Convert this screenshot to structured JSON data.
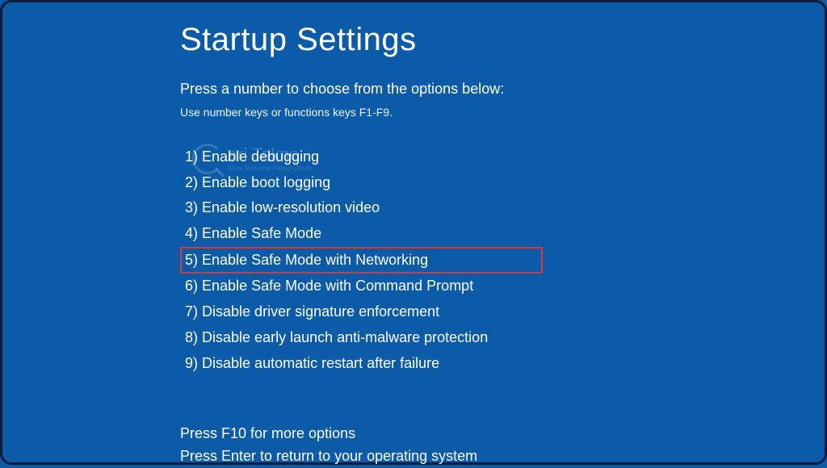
{
  "title": "Startup Settings",
  "subtitle": "Press a number to choose from the options below:",
  "hint": "Use number keys or functions keys F1-F9.",
  "options": [
    {
      "num": "1)",
      "label": "Enable debugging",
      "highlighted": false
    },
    {
      "num": "2)",
      "label": "Enable boot logging",
      "highlighted": false
    },
    {
      "num": "3)",
      "label": "Enable low-resolution video",
      "highlighted": false
    },
    {
      "num": "4)",
      "label": "Enable Safe Mode",
      "highlighted": false
    },
    {
      "num": "5)",
      "label": "Enable Safe Mode with Networking",
      "highlighted": true
    },
    {
      "num": "6)",
      "label": "Enable Safe Mode with Command Prompt",
      "highlighted": false
    },
    {
      "num": "7)",
      "label": "Disable driver signature enforcement",
      "highlighted": false
    },
    {
      "num": "8)",
      "label": "Disable early launch anti-malware protection",
      "highlighted": false
    },
    {
      "num": "9)",
      "label": "Disable automatic restart after failure",
      "highlighted": false
    }
  ],
  "footer": {
    "more": "Press F10 for more options",
    "return": "Press Enter to return to your operating system"
  },
  "watermark": {
    "brand": "ari Tekno",
    "tagline": "Situs Teknologi Paling Cihuat"
  },
  "colors": {
    "background": "#0b5ba8",
    "highlight_border": "#d93832",
    "frame_border": "#0a1b3d"
  }
}
